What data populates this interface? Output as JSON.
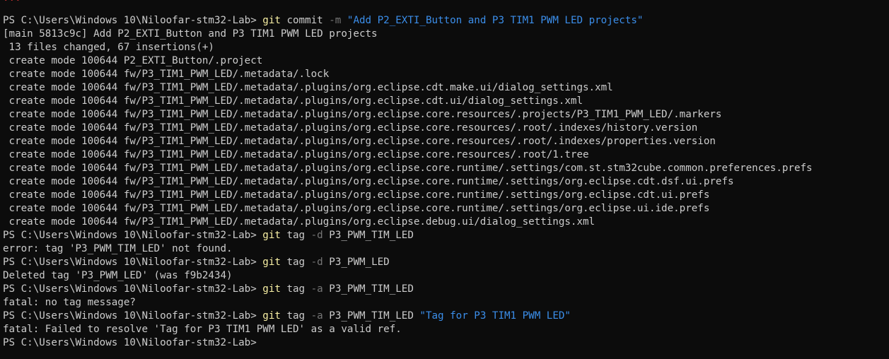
{
  "window": {
    "top_partial_line": "...",
    "colors": {
      "background": "#0c0c0c",
      "foreground": "#cccccc",
      "command": "#f9f1a5",
      "flag": "#767676",
      "string": "#3b8eea"
    }
  },
  "lines": [
    {
      "kind": "command",
      "segments": [
        {
          "text": "PS C:\\Users\\Windows 10\\Niloofar-stm32-Lab> ",
          "style": "plain"
        },
        {
          "text": "git",
          "style": "cmd"
        },
        {
          "text": " commit ",
          "style": "plain"
        },
        {
          "text": "-m",
          "style": "flag"
        },
        {
          "text": " \"Add P2_EXTI_Button and P3 TIM1 PWM LED projects\"",
          "style": "str"
        }
      ]
    },
    {
      "kind": "output",
      "segments": [
        {
          "text": "[main 5813c9c] Add P2_EXTI_Button and P3 TIM1 PWM LED projects",
          "style": "plain"
        }
      ]
    },
    {
      "kind": "output",
      "segments": [
        {
          "text": " 13 files changed, 67 insertions(+)",
          "style": "plain"
        }
      ]
    },
    {
      "kind": "output",
      "segments": [
        {
          "text": " create mode 100644 P2_EXTI_Button/.project",
          "style": "plain"
        }
      ]
    },
    {
      "kind": "output",
      "segments": [
        {
          "text": " create mode 100644 fw/P3_TIM1_PWM_LED/.metadata/.lock",
          "style": "plain"
        }
      ]
    },
    {
      "kind": "output",
      "segments": [
        {
          "text": " create mode 100644 fw/P3_TIM1_PWM_LED/.metadata/.plugins/org.eclipse.cdt.make.ui/dialog_settings.xml",
          "style": "plain"
        }
      ]
    },
    {
      "kind": "output",
      "segments": [
        {
          "text": " create mode 100644 fw/P3_TIM1_PWM_LED/.metadata/.plugins/org.eclipse.cdt.ui/dialog_settings.xml",
          "style": "plain"
        }
      ]
    },
    {
      "kind": "output",
      "segments": [
        {
          "text": " create mode 100644 fw/P3_TIM1_PWM_LED/.metadata/.plugins/org.eclipse.core.resources/.projects/P3_TIM1_PWM_LED/.markers",
          "style": "plain"
        }
      ]
    },
    {
      "kind": "output",
      "segments": [
        {
          "text": " create mode 100644 fw/P3_TIM1_PWM_LED/.metadata/.plugins/org.eclipse.core.resources/.root/.indexes/history.version",
          "style": "plain"
        }
      ]
    },
    {
      "kind": "output",
      "segments": [
        {
          "text": " create mode 100644 fw/P3_TIM1_PWM_LED/.metadata/.plugins/org.eclipse.core.resources/.root/.indexes/properties.version",
          "style": "plain"
        }
      ]
    },
    {
      "kind": "output",
      "segments": [
        {
          "text": " create mode 100644 fw/P3_TIM1_PWM_LED/.metadata/.plugins/org.eclipse.core.resources/.root/1.tree",
          "style": "plain"
        }
      ]
    },
    {
      "kind": "output",
      "segments": [
        {
          "text": " create mode 100644 fw/P3_TIM1_PWM_LED/.metadata/.plugins/org.eclipse.core.runtime/.settings/com.st.stm32cube.common.preferences.prefs",
          "style": "plain"
        }
      ]
    },
    {
      "kind": "output",
      "segments": [
        {
          "text": " create mode 100644 fw/P3_TIM1_PWM_LED/.metadata/.plugins/org.eclipse.core.runtime/.settings/org.eclipse.cdt.dsf.ui.prefs",
          "style": "plain"
        }
      ]
    },
    {
      "kind": "output",
      "segments": [
        {
          "text": " create mode 100644 fw/P3_TIM1_PWM_LED/.metadata/.plugins/org.eclipse.core.runtime/.settings/org.eclipse.cdt.ui.prefs",
          "style": "plain"
        }
      ]
    },
    {
      "kind": "output",
      "segments": [
        {
          "text": " create mode 100644 fw/P3_TIM1_PWM_LED/.metadata/.plugins/org.eclipse.core.runtime/.settings/org.eclipse.ui.ide.prefs",
          "style": "plain"
        }
      ]
    },
    {
      "kind": "output",
      "segments": [
        {
          "text": " create mode 100644 fw/P3_TIM1_PWM_LED/.metadata/.plugins/org.eclipse.debug.ui/dialog_settings.xml",
          "style": "plain"
        }
      ]
    },
    {
      "kind": "command",
      "segments": [
        {
          "text": "PS C:\\Users\\Windows 10\\Niloofar-stm32-Lab> ",
          "style": "plain"
        },
        {
          "text": "git",
          "style": "cmd"
        },
        {
          "text": " tag ",
          "style": "plain"
        },
        {
          "text": "-d",
          "style": "flag"
        },
        {
          "text": " P3_PWM_TIM_LED",
          "style": "plain"
        }
      ]
    },
    {
      "kind": "output",
      "segments": [
        {
          "text": "error: tag 'P3_PWM_TIM_LED' not found.",
          "style": "plain"
        }
      ]
    },
    {
      "kind": "command",
      "segments": [
        {
          "text": "PS C:\\Users\\Windows 10\\Niloofar-stm32-Lab> ",
          "style": "plain"
        },
        {
          "text": "git",
          "style": "cmd"
        },
        {
          "text": " tag ",
          "style": "plain"
        },
        {
          "text": "-d",
          "style": "flag"
        },
        {
          "text": " P3_PWM_LED",
          "style": "plain"
        }
      ]
    },
    {
      "kind": "output",
      "segments": [
        {
          "text": "Deleted tag 'P3_PWM_LED' (was f9b2434)",
          "style": "plain"
        }
      ]
    },
    {
      "kind": "command",
      "segments": [
        {
          "text": "PS C:\\Users\\Windows 10\\Niloofar-stm32-Lab> ",
          "style": "plain"
        },
        {
          "text": "git",
          "style": "cmd"
        },
        {
          "text": " tag ",
          "style": "plain"
        },
        {
          "text": "-a",
          "style": "flag"
        },
        {
          "text": " P3_PWM_TIM_LED",
          "style": "plain"
        }
      ]
    },
    {
      "kind": "output",
      "segments": [
        {
          "text": "fatal: no tag message?",
          "style": "plain"
        }
      ]
    },
    {
      "kind": "command",
      "segments": [
        {
          "text": "PS C:\\Users\\Windows 10\\Niloofar-stm32-Lab> ",
          "style": "plain"
        },
        {
          "text": "git",
          "style": "cmd"
        },
        {
          "text": " tag ",
          "style": "plain"
        },
        {
          "text": "-a",
          "style": "flag"
        },
        {
          "text": " P3_PWM_TIM_LED ",
          "style": "plain"
        },
        {
          "text": "\"Tag for P3 TIM1 PWM LED\"",
          "style": "str"
        }
      ]
    },
    {
      "kind": "output",
      "segments": [
        {
          "text": "fatal: Failed to resolve 'Tag for P3 TIM1 PWM LED' as a valid ref.",
          "style": "plain"
        }
      ]
    },
    {
      "kind": "prompt",
      "segments": [
        {
          "text": "PS C:\\Users\\Windows 10\\Niloofar-stm32-Lab>",
          "style": "plain"
        }
      ]
    }
  ]
}
